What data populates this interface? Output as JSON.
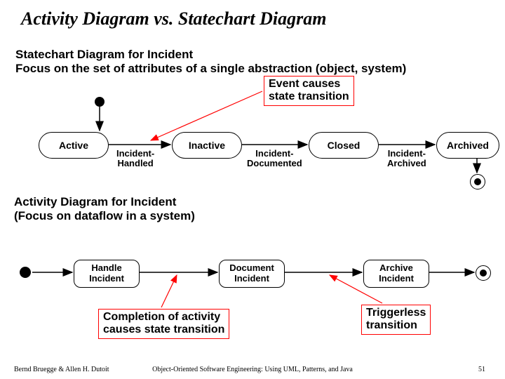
{
  "title": "Activity Diagram vs. Statechart Diagram",
  "statechart": {
    "heading_l1": "Statechart Diagram for Incident",
    "heading_l2": "Focus on the set of attributes of a single abstraction (object, system)",
    "event_note_l1": "Event causes",
    "event_note_l2": "state transition",
    "states": {
      "active": "Active",
      "inactive": "Inactive",
      "closed": "Closed",
      "archived": "Archived"
    },
    "transitions": {
      "t1_l1": "Incident-",
      "t1_l2": "Handled",
      "t2_l1": "Incident-",
      "t2_l2": "Documented",
      "t3_l1": "Incident-",
      "t3_l2": "Archived"
    }
  },
  "activity": {
    "heading_l1": "Activity Diagram for Incident",
    "heading_l2": "(Focus on dataflow in a system)",
    "nodes": {
      "handle_l1": "Handle",
      "handle_l2": "Incident",
      "document_l1": "Document",
      "document_l2": "Incident",
      "archive_l1": "Archive",
      "archive_l2": "Incident"
    },
    "completion_note_l1": "Completion of activity",
    "completion_note_l2": "causes state transition",
    "triggerless_note_l1": "Triggerless",
    "triggerless_note_l2": "transition"
  },
  "footer": {
    "left": "Bernd Bruegge & Allen H. Dutoit",
    "center": "Object-Oriented Software Engineering: Using UML, Patterns, and Java",
    "right": "51"
  }
}
